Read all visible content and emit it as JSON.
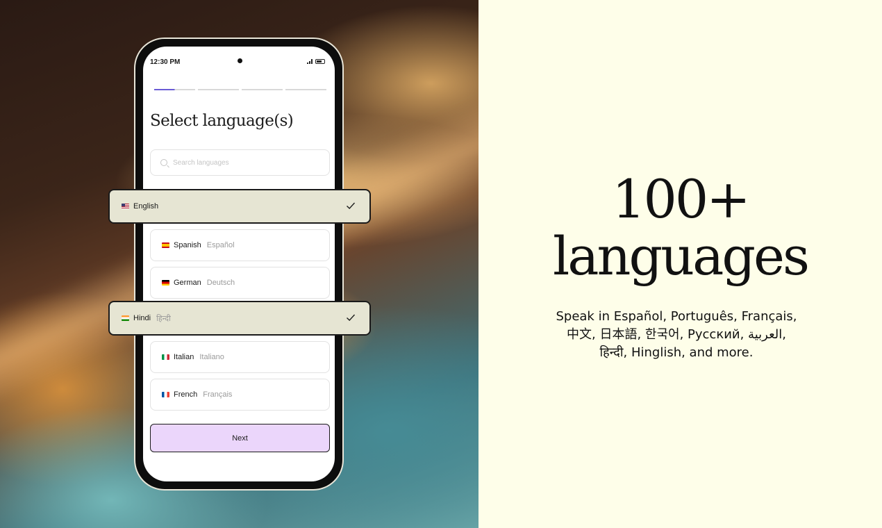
{
  "phone": {
    "status_time": "12:30 PM",
    "title": "Select language(s)",
    "search_placeholder": "Search languages",
    "languages": [
      {
        "name": "Spanish",
        "native": "Español",
        "flag": "spain-flag-icon"
      },
      {
        "name": "German",
        "native": "Deutsch",
        "flag": "germany-flag-icon"
      },
      {
        "name": "Italian",
        "native": "Italiano",
        "flag": "italy-flag-icon"
      },
      {
        "name": "French",
        "native": "Français",
        "flag": "france-flag-icon"
      }
    ],
    "selected": [
      {
        "name": "English",
        "native": "",
        "flag": "us-flag-icon"
      },
      {
        "name": "Hindi",
        "native": "हिन्दी",
        "flag": "india-flag-icon"
      }
    ],
    "next_label": "Next",
    "progress_steps": 4,
    "progress_current": 1
  },
  "hero": {
    "headline_line1": "100+",
    "headline_line2": "languages",
    "description_line1": "Speak in Español, Português, Français,",
    "description_line2": "中文, 日本語, 한국어, Русский, العربية,",
    "description_line3": "हिन्दी, Hinglish, and more."
  },
  "colors": {
    "next_button_bg": "#ebd6fb",
    "selected_card_bg": "#e6e5d3",
    "progress_active": "#6a5bd6",
    "page_bg": "#fefee9"
  }
}
